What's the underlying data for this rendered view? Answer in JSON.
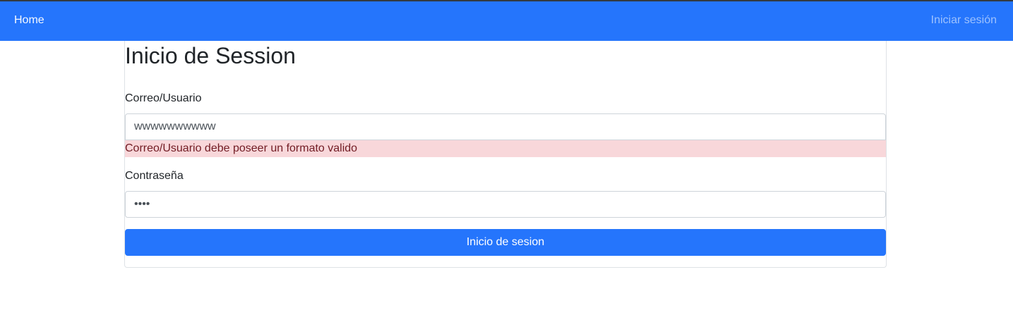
{
  "navbar": {
    "home_label": "Home",
    "login_label": "Iniciar sesión",
    "background_color": "#2575fc"
  },
  "form": {
    "title": "Inicio de Session",
    "email": {
      "label": "Correo/Usuario",
      "value": "wwwwwwwwww",
      "error": "Correo/Usuario debe poseer un formato valido"
    },
    "password": {
      "label": "Contraseña",
      "value": "1234"
    },
    "submit_label": "Inicio de sesion"
  }
}
